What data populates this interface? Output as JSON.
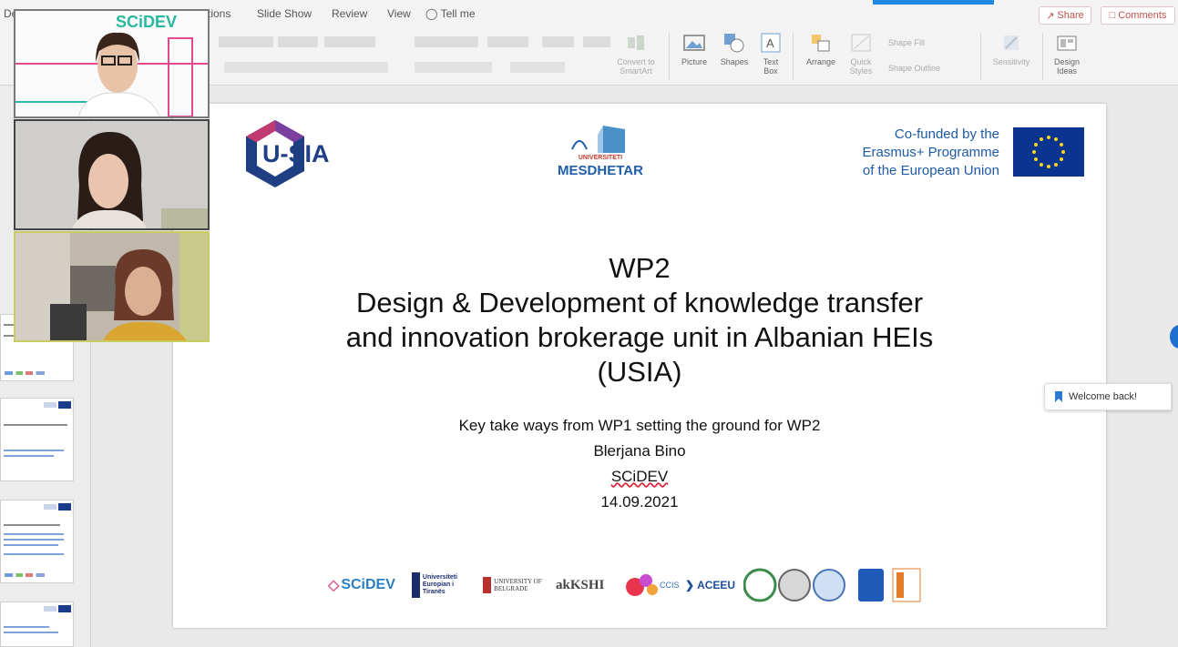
{
  "menu": {
    "items": [
      "De",
      "tions",
      "Slide Show",
      "Review",
      "View"
    ],
    "tell_me": "Tell me",
    "share": "Share",
    "comments": "Comments"
  },
  "ribbon": {
    "convert_smartart": "Convert to SmartArt",
    "picture": "Picture",
    "shapes": "Shapes",
    "text_box": "Text Box",
    "arrange": "Arrange",
    "quick_styles": "Quick Styles",
    "shape_fill": "Shape Fill",
    "shape_outline": "Shape Outline",
    "sensitivity": "Sensitivity",
    "design_ideas": "Design Ideas"
  },
  "slide": {
    "logo_left": "U-SIA",
    "logo_center_sub": "UNIVERSITETI",
    "logo_center_name": "MESDHETAR",
    "cofund_line1": "Co-funded by the",
    "cofund_line2": "Erasmus+ Programme",
    "cofund_line3": "of the European Union",
    "title_line1": "WP2",
    "title_line2": "Design & Development of knowledge transfer",
    "title_line3": "and innovation brokerage unit in Albanian HEIs",
    "title_line4": "(USIA)",
    "sub_line1": "Key take ways from WP1 setting the ground for WP2",
    "sub_line2": "Blerjana Bino",
    "sub_line3": "SCiDEV",
    "sub_line4": "14.09.2021",
    "partners": [
      "SCiDEV",
      "Universiteti Europian i Tiranës",
      "UNIVERSITY OF BELGRADE",
      "akKSHI",
      "CCIS",
      "ACEEU"
    ]
  },
  "video": {
    "tile1_label": "SCiDEV"
  },
  "toast": {
    "welcome": "Welcome back!"
  },
  "colors": {
    "accent_red": "#c0504d",
    "usia_blue": "#1e3f84",
    "eu_blue": "#0b3491",
    "teal": "#2bb8a0"
  }
}
